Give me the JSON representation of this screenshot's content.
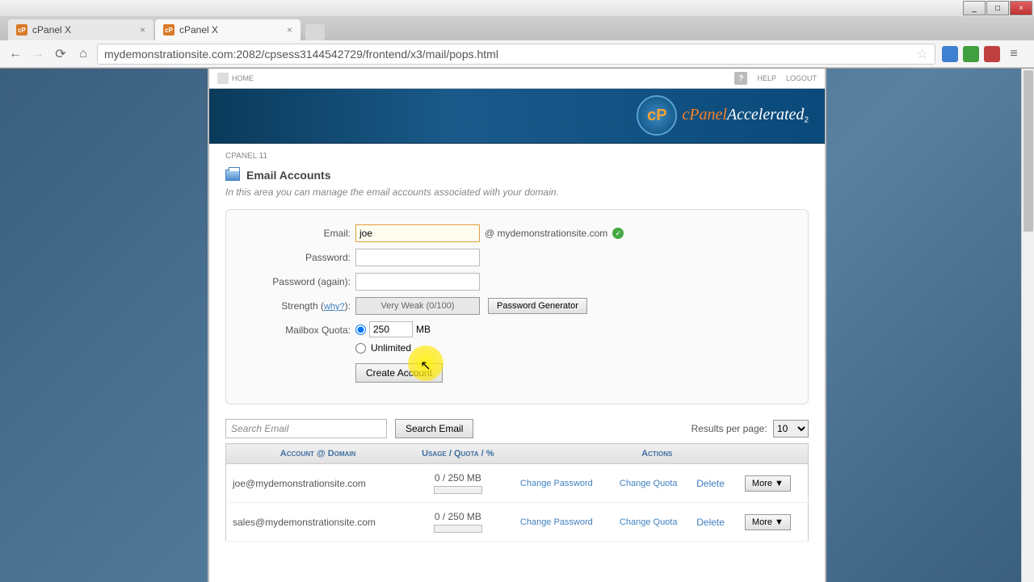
{
  "window": {
    "minimize": "_",
    "maximize": "□",
    "close": "×"
  },
  "tabs": [
    {
      "label": "cPanel X",
      "active": false
    },
    {
      "label": "cPanel X",
      "active": true
    }
  ],
  "url": "mydemonstrationsite.com:2082/cpsess3144542729/frontend/x3/mail/pops.html",
  "topbar": {
    "home": "HOME",
    "help": "HELP",
    "logout": "LOGOUT",
    "help_badge": "?"
  },
  "banner": {
    "brand": "cPanel",
    "suffix": "Accelerated",
    "sub": "2"
  },
  "breadcrumb": "CPANEL 11",
  "page": {
    "title": "Email Accounts",
    "description": "In this area you can manage the email accounts associated with your domain."
  },
  "form": {
    "email_label": "Email:",
    "email_value": "joe",
    "domain": "@ mydemonstrationsite.com",
    "password_label": "Password:",
    "password_again_label": "Password (again):",
    "strength_label": "Strength",
    "why_label": "why?",
    "strength_value": "Very Weak (0/100)",
    "generator_btn": "Password Generator",
    "quota_label": "Mailbox Quota:",
    "quota_value": "250",
    "quota_unit": "MB",
    "unlimited_label": "Unlimited",
    "create_btn": "Create Account"
  },
  "search": {
    "placeholder": "Search Email",
    "button": "Search Email",
    "results_label": "Results per page:",
    "results_value": "10"
  },
  "table": {
    "col_account": "Account @ Domain",
    "col_usage": "Usage / Quota / %",
    "col_actions": "Actions",
    "rows": [
      {
        "email": "joe@mydemonstrationsite.com",
        "usage": "0 / 250 MB",
        "change_pw": "Change Password",
        "change_quota": "Change Quota",
        "delete": "Delete",
        "more": "More ▼"
      },
      {
        "email": "sales@mydemonstrationsite.com",
        "usage": "0 / 250 MB",
        "change_pw": "Change Password",
        "change_quota": "Change Quota",
        "delete": "Delete",
        "more": "More ▼"
      }
    ]
  }
}
